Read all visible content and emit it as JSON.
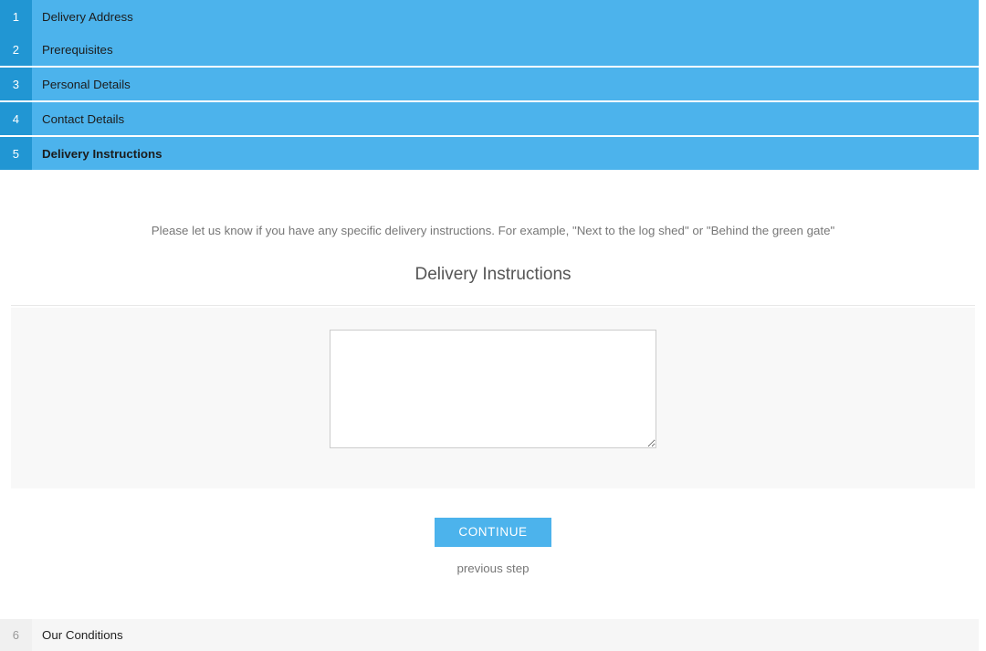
{
  "accordion": {
    "top_steps": [
      {
        "number": "1",
        "label": "Delivery Address",
        "active": false,
        "separator_above": false
      },
      {
        "number": "2",
        "label": "Prerequisites",
        "active": false,
        "separator_above": false
      },
      {
        "number": "3",
        "label": "Personal Details",
        "active": false,
        "separator_above": true
      },
      {
        "number": "4",
        "label": "Contact Details",
        "active": false,
        "separator_above": true
      },
      {
        "number": "5",
        "label": "Delivery Instructions",
        "active": true,
        "separator_above": true
      }
    ],
    "bottom_steps": [
      {
        "number": "6",
        "label": "Our Conditions",
        "active": false
      }
    ]
  },
  "content": {
    "intro": "Please let us know if you have any specific delivery instructions. For example, \"Next to the log shed\" or \"Behind the green gate\"",
    "heading": "Delivery Instructions",
    "textarea": {
      "value": "",
      "placeholder": ""
    }
  },
  "actions": {
    "continue_label": "CONTINUE",
    "previous_label": "previous step"
  },
  "colors": {
    "accent_blue": "#4cb3ec",
    "number_blue": "#2196d3",
    "panel_gray": "#f8f8f8",
    "muted_text": "#777777"
  },
  "step_numbers": {
    "s1": "1",
    "s2": "2",
    "s3": "3",
    "s4": "4",
    "s5": "5",
    "s6": "6"
  },
  "step_labels": {
    "l1": "Delivery Address",
    "l2": "Prerequisites",
    "l3": "Personal Details",
    "l4": "Contact Details",
    "l5": "Delivery Instructions",
    "l6": "Our Conditions"
  }
}
